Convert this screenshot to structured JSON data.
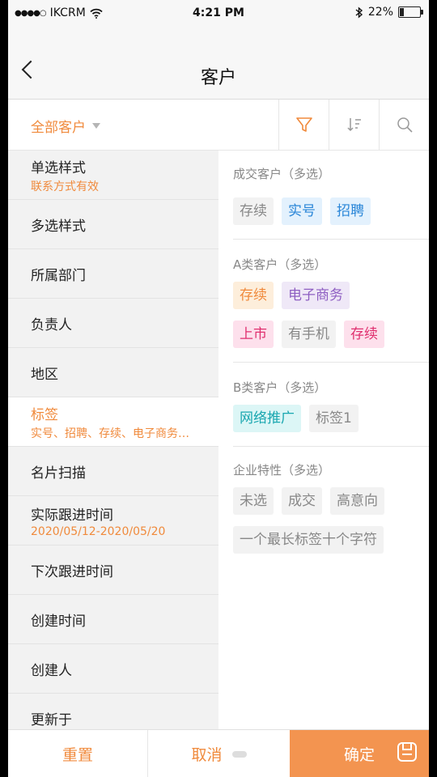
{
  "status_bar": {
    "carrier": "IKCRM",
    "time": "4:21 PM",
    "battery_text": "22%",
    "battery_level": 0.22,
    "signal_dots": "●●●●○"
  },
  "nav": {
    "title": "客户"
  },
  "filter": {
    "scope_label": "全部客户"
  },
  "menu": [
    {
      "label": "单选样式",
      "sub": "联系方式有效",
      "active": false
    },
    {
      "label": "多选样式",
      "sub": "",
      "active": false
    },
    {
      "label": "所属部门",
      "sub": "",
      "active": false
    },
    {
      "label": "负责人",
      "sub": "",
      "active": false
    },
    {
      "label": "地区",
      "sub": "",
      "active": false
    },
    {
      "label": "标签",
      "sub": "实号、招聘、存续、电子商务…",
      "active": true
    },
    {
      "label": "名片扫描",
      "sub": "",
      "active": false
    },
    {
      "label": "实际跟进时间",
      "sub": "2020/05/12-2020/05/20",
      "active": false
    },
    {
      "label": "下次跟进时间",
      "sub": "",
      "active": false
    },
    {
      "label": "创建时间",
      "sub": "",
      "active": false
    },
    {
      "label": "创建人",
      "sub": "",
      "active": false
    },
    {
      "label": "更新于",
      "sub": "",
      "active": false
    }
  ],
  "tag_groups": [
    {
      "title": "成交客户（多选）",
      "tags": [
        {
          "text": "存续",
          "style": "gray"
        },
        {
          "text": "实号",
          "style": "blue"
        },
        {
          "text": "招聘",
          "style": "blue"
        }
      ]
    },
    {
      "title": "A类客户（多选）",
      "tags": [
        {
          "text": "存续",
          "style": "orange"
        },
        {
          "text": "电子商务",
          "style": "purple"
        },
        {
          "text": "上市",
          "style": "pink"
        },
        {
          "text": "有手机",
          "style": "gray"
        },
        {
          "text": "存续",
          "style": "pink"
        }
      ]
    },
    {
      "title": "B类客户（多选）",
      "tags": [
        {
          "text": "网络推广",
          "style": "cyan"
        },
        {
          "text": "标签1",
          "style": "gray"
        }
      ]
    },
    {
      "title": "企业特性（多选）",
      "tags": [
        {
          "text": "未选",
          "style": "gray"
        },
        {
          "text": "成交",
          "style": "gray"
        },
        {
          "text": "高意向",
          "style": "gray"
        },
        {
          "text": "一个最长标签十个字符",
          "style": "gray"
        }
      ]
    }
  ],
  "tag_colors": {
    "gray": {
      "bg": "#f2f2f2",
      "fg": "#888888"
    },
    "blue": {
      "bg": "#e3f1fd",
      "fg": "#2a86d8"
    },
    "orange": {
      "bg": "#fdeedb",
      "fg": "#f08a3c"
    },
    "purple": {
      "bg": "#efe8f7",
      "fg": "#8e5fc2"
    },
    "pink": {
      "bg": "#fde0ec",
      "fg": "#e0306f"
    },
    "cyan": {
      "bg": "#dcf6f6",
      "fg": "#1aa7b0"
    }
  },
  "bottom": {
    "reset_label": "重置",
    "cancel_label": "取消",
    "confirm_label": "确定"
  },
  "accent_color": "#f08a3c"
}
